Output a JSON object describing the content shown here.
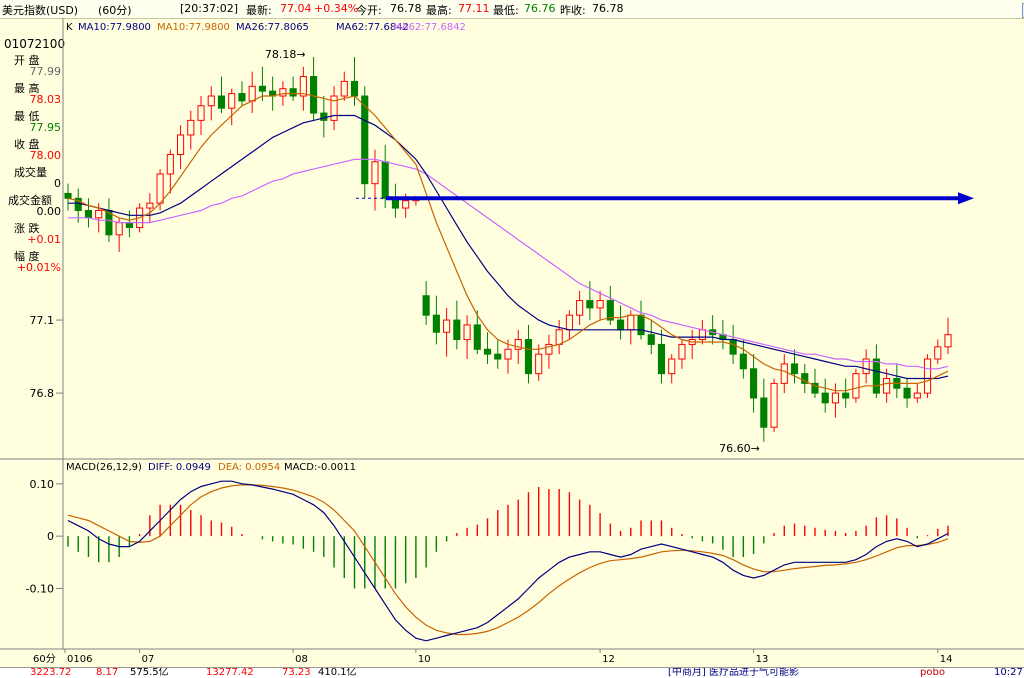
{
  "header": {
    "instrument": "美元指数(USD)",
    "period": "(60分)",
    "time": "[20:37:02]",
    "latest_label": "最新:",
    "latest": "77.04",
    "change_pct": "+0.34%",
    "open_label": "今开:",
    "open": "76.78",
    "high_label": "最高:",
    "high": "77.11",
    "low_label": "最低:",
    "low": "76.76",
    "prevclose_label": "昨收:",
    "prevclose": "76.78"
  },
  "legend": {
    "k": "K",
    "ma10a": "MA10:77.9800",
    "ma10b": "MA10:77.9800",
    "ma26": "MA26:77.8065",
    "ma62a": "MA62:77.6842",
    "ma62b": "MA62:77.6842"
  },
  "colors": {
    "bg": "#ffffe0",
    "up": "#ff0000",
    "down": "#008000",
    "ma10": "#c86400",
    "ma26": "#000080",
    "ma62": "#cc66ff",
    "arrow": "#0000cc",
    "axis": "#808080"
  },
  "info_panel": {
    "date": "01072100",
    "open_label": "开 盘",
    "open": "77.99",
    "high_label": "最 高",
    "high": "78.03",
    "low_label": "最 低",
    "low": "77.95",
    "close_label": "收 盘",
    "close": "78.00",
    "vol_label": "成交量",
    "vol": "0",
    "amount_label": "成交金额",
    "amount": "0.00",
    "chg_label": "涨 跌",
    "chg": "+0.01",
    "range_label": "幅 度",
    "range": "+0.01%"
  },
  "price_axis": {
    "ticks": [
      "77.1",
      "76.8"
    ]
  },
  "annotations": {
    "high_mark": "78.18",
    "low_mark": "76.60"
  },
  "macd_legend": {
    "name": "MACD(26,12,9)",
    "diff": "DIFF: 0.0949",
    "dea": "DEA: 0.0954",
    "macd": "MACD:-0.0011"
  },
  "macd_axis": {
    "ticks": [
      "0.10",
      "0",
      "-0.10"
    ]
  },
  "x_axis": {
    "period_label": "60分",
    "labels": [
      "0106",
      "07",
      "08",
      "10",
      "12",
      "13",
      "14"
    ]
  },
  "bottom_bar": {
    "a": "3223.72",
    "b": "8.17",
    "c": "575.5亿",
    "d": "13277.42",
    "e": "73.23",
    "f": "410.1亿",
    "news": "[中商月]  医疗品进于气可能影",
    "brand": "pobo",
    "clock": "10:27"
  },
  "chart_data": {
    "type": "candlestick",
    "price_range": [
      76.55,
      78.25
    ],
    "candles": [
      [
        77.62,
        77.66,
        77.55,
        77.6
      ],
      [
        77.6,
        77.64,
        77.5,
        77.55
      ],
      [
        77.55,
        77.6,
        77.48,
        77.52
      ],
      [
        77.52,
        77.58,
        77.46,
        77.55
      ],
      [
        77.55,
        77.6,
        77.42,
        77.45
      ],
      [
        77.45,
        77.52,
        77.38,
        77.5
      ],
      [
        77.5,
        77.55,
        77.44,
        77.48
      ],
      [
        77.48,
        77.58,
        77.46,
        77.56
      ],
      [
        77.56,
        77.62,
        77.5,
        77.58
      ],
      [
        77.58,
        77.72,
        77.55,
        77.7
      ],
      [
        77.7,
        77.8,
        77.62,
        77.78
      ],
      [
        77.78,
        77.9,
        77.72,
        77.86
      ],
      [
        77.86,
        77.96,
        77.8,
        77.92
      ],
      [
        77.92,
        78.02,
        77.86,
        77.98
      ],
      [
        77.98,
        78.06,
        77.92,
        78.02
      ],
      [
        78.02,
        78.1,
        77.95,
        77.97
      ],
      [
        77.97,
        78.05,
        77.9,
        78.03
      ],
      [
        78.03,
        78.08,
        77.98,
        78.0
      ],
      [
        78.0,
        78.12,
        77.95,
        78.06
      ],
      [
        78.06,
        78.14,
        78.0,
        78.04
      ],
      [
        78.04,
        78.1,
        77.96,
        78.02
      ],
      [
        78.02,
        78.08,
        77.98,
        78.05
      ],
      [
        78.05,
        78.1,
        78.0,
        78.02
      ],
      [
        78.02,
        78.14,
        77.96,
        78.1
      ],
      [
        78.1,
        78.18,
        77.92,
        77.95
      ],
      [
        77.95,
        78.02,
        77.85,
        77.92
      ],
      [
        77.92,
        78.06,
        77.88,
        78.02
      ],
      [
        78.02,
        78.12,
        78.0,
        78.08
      ],
      [
        78.08,
        78.18,
        77.98,
        78.02
      ],
      [
        78.02,
        78.06,
        77.6,
        77.66
      ],
      [
        77.66,
        77.8,
        77.55,
        77.75
      ],
      [
        77.75,
        77.82,
        77.56,
        77.6
      ],
      [
        77.6,
        77.66,
        77.52,
        77.56
      ],
      [
        77.56,
        77.62,
        77.52,
        77.59
      ],
      [
        77.59,
        77.61,
        77.57,
        77.6
      ],
      [
        77.2,
        77.26,
        77.08,
        77.12
      ],
      [
        77.12,
        77.2,
        77.0,
        77.05
      ],
      [
        77.05,
        77.15,
        76.95,
        77.1
      ],
      [
        77.1,
        77.18,
        76.98,
        77.02
      ],
      [
        77.02,
        77.12,
        76.94,
        77.08
      ],
      [
        77.08,
        77.14,
        76.96,
        76.98
      ],
      [
        76.98,
        77.05,
        76.92,
        76.96
      ],
      [
        76.96,
        77.02,
        76.9,
        76.94
      ],
      [
        76.94,
        77.02,
        76.88,
        76.98
      ],
      [
        76.98,
        77.06,
        76.92,
        77.02
      ],
      [
        77.02,
        77.08,
        76.84,
        76.88
      ],
      [
        76.88,
        77.0,
        76.85,
        76.96
      ],
      [
        76.96,
        77.04,
        76.9,
        77.0
      ],
      [
        77.0,
        77.1,
        76.96,
        77.06
      ],
      [
        77.06,
        77.14,
        77.02,
        77.12
      ],
      [
        77.12,
        77.22,
        77.08,
        77.18
      ],
      [
        77.18,
        77.26,
        77.1,
        77.15
      ],
      [
        77.15,
        77.22,
        77.1,
        77.18
      ],
      [
        77.18,
        77.24,
        77.08,
        77.1
      ],
      [
        77.1,
        77.16,
        77.02,
        77.06
      ],
      [
        77.06,
        77.14,
        77.0,
        77.12
      ],
      [
        77.12,
        77.18,
        77.02,
        77.04
      ],
      [
        77.04,
        77.1,
        76.96,
        77.0
      ],
      [
        77.0,
        77.06,
        76.84,
        76.88
      ],
      [
        76.88,
        76.96,
        76.84,
        76.94
      ],
      [
        76.94,
        77.02,
        76.9,
        77.0
      ],
      [
        77.0,
        77.06,
        76.94,
        77.02
      ],
      [
        77.02,
        77.1,
        77.0,
        77.06
      ],
      [
        77.06,
        77.12,
        77.0,
        77.04
      ],
      [
        77.04,
        77.1,
        76.98,
        77.02
      ],
      [
        77.02,
        77.08,
        76.92,
        76.96
      ],
      [
        76.96,
        77.02,
        76.86,
        76.9
      ],
      [
        76.9,
        76.96,
        76.72,
        76.78
      ],
      [
        76.78,
        76.86,
        76.6,
        76.66
      ],
      [
        76.66,
        76.86,
        76.64,
        76.84
      ],
      [
        76.84,
        76.96,
        76.8,
        76.92
      ],
      [
        76.92,
        76.98,
        76.84,
        76.88
      ],
      [
        76.88,
        76.92,
        76.8,
        76.84
      ],
      [
        76.84,
        76.9,
        76.78,
        76.8
      ],
      [
        76.8,
        76.86,
        76.72,
        76.76
      ],
      [
        76.76,
        76.84,
        76.7,
        76.8
      ],
      [
        76.8,
        76.86,
        76.74,
        76.78
      ],
      [
        76.78,
        76.9,
        76.76,
        76.88
      ],
      [
        76.88,
        76.98,
        76.84,
        76.94
      ],
      [
        76.94,
        77.0,
        76.78,
        76.8
      ],
      [
        76.8,
        76.9,
        76.76,
        76.86
      ],
      [
        76.86,
        76.92,
        76.78,
        76.82
      ],
      [
        76.82,
        76.86,
        76.74,
        76.78
      ],
      [
        76.78,
        76.84,
        76.76,
        76.8
      ],
      [
        76.8,
        76.96,
        76.78,
        76.94
      ],
      [
        76.94,
        77.02,
        76.92,
        76.99
      ],
      [
        76.99,
        77.11,
        76.96,
        77.04
      ]
    ],
    "ma10": [
      77.6,
      77.59,
      77.57,
      77.56,
      77.54,
      77.52,
      77.51,
      77.52,
      77.54,
      77.58,
      77.63,
      77.69,
      77.75,
      77.81,
      77.86,
      77.9,
      77.94,
      77.98,
      78.0,
      78.02,
      78.02,
      78.03,
      78.03,
      78.03,
      78.02,
      78.01,
      78.0,
      78.01,
      78.02,
      77.98,
      77.94,
      77.89,
      77.84,
      77.79,
      77.74,
      77.62,
      77.5,
      77.4,
      77.3,
      77.2,
      77.12,
      77.06,
      77.02,
      77.0,
      76.99,
      76.98,
      76.98,
      76.99,
      77.0,
      77.02,
      77.05,
      77.08,
      77.1,
      77.11,
      77.11,
      77.12,
      77.12,
      77.1,
      77.07,
      77.04,
      77.02,
      77.01,
      77.01,
      77.01,
      77.01,
      77.0,
      76.98,
      76.95,
      76.92,
      76.9,
      76.89,
      76.87,
      76.85,
      76.83,
      76.82,
      76.81,
      76.81,
      76.82,
      76.83,
      76.83,
      76.84,
      76.84,
      76.84,
      76.84,
      76.85,
      76.87,
      76.89
    ],
    "ma26": [
      77.58,
      77.58,
      77.57,
      77.56,
      77.55,
      77.54,
      77.53,
      77.53,
      77.53,
      77.54,
      77.56,
      77.58,
      77.61,
      77.64,
      77.67,
      77.7,
      77.73,
      77.76,
      77.79,
      77.82,
      77.85,
      77.87,
      77.89,
      77.91,
      77.92,
      77.93,
      77.94,
      77.94,
      77.94,
      77.92,
      77.9,
      77.87,
      77.84,
      77.8,
      77.76,
      77.7,
      77.63,
      77.56,
      77.49,
      77.42,
      77.36,
      77.3,
      77.25,
      77.2,
      77.16,
      77.13,
      77.1,
      77.08,
      77.07,
      77.06,
      77.06,
      77.06,
      77.06,
      77.06,
      77.06,
      77.06,
      77.06,
      77.05,
      77.04,
      77.03,
      77.03,
      77.03,
      77.03,
      77.03,
      77.02,
      77.02,
      77.01,
      77.0,
      76.99,
      76.98,
      76.97,
      76.96,
      76.95,
      76.94,
      76.93,
      76.92,
      76.91,
      76.91,
      76.9,
      76.89,
      76.88,
      76.87,
      76.86,
      76.86,
      76.86,
      76.86,
      76.87
    ],
    "ma62": [
      77.52,
      77.52,
      77.52,
      77.51,
      77.51,
      77.5,
      77.5,
      77.5,
      77.5,
      77.51,
      77.52,
      77.53,
      77.54,
      77.55,
      77.57,
      77.58,
      77.6,
      77.61,
      77.63,
      77.65,
      77.67,
      77.68,
      77.7,
      77.71,
      77.72,
      77.73,
      77.74,
      77.75,
      77.76,
      77.76,
      77.76,
      77.75,
      77.74,
      77.73,
      77.72,
      77.7,
      77.67,
      77.64,
      77.61,
      77.58,
      77.55,
      77.52,
      77.49,
      77.46,
      77.43,
      77.4,
      77.37,
      77.34,
      77.31,
      77.28,
      77.25,
      77.23,
      77.21,
      77.19,
      77.17,
      77.15,
      77.13,
      77.12,
      77.1,
      77.09,
      77.08,
      77.07,
      77.06,
      77.05,
      77.04,
      77.03,
      77.02,
      77.01,
      77.0,
      76.99,
      76.98,
      76.97,
      76.96,
      76.96,
      76.95,
      76.94,
      76.94,
      76.93,
      76.93,
      76.93,
      76.92,
      76.92,
      76.91,
      76.91,
      76.9,
      76.9,
      76.91
    ],
    "macd_range": [
      -0.21,
      0.115
    ],
    "diff": [
      0.03,
      0.02,
      0.01,
      -0.005,
      -0.015,
      -0.02,
      -0.02,
      -0.01,
      0.01,
      0.03,
      0.05,
      0.07,
      0.085,
      0.095,
      0.1,
      0.105,
      0.105,
      0.1,
      0.098,
      0.094,
      0.09,
      0.085,
      0.08,
      0.07,
      0.06,
      0.045,
      0.02,
      -0.01,
      -0.04,
      -0.07,
      -0.1,
      -0.13,
      -0.16,
      -0.18,
      -0.195,
      -0.2,
      -0.195,
      -0.19,
      -0.185,
      -0.18,
      -0.175,
      -0.165,
      -0.15,
      -0.135,
      -0.12,
      -0.1,
      -0.08,
      -0.065,
      -0.05,
      -0.04,
      -0.035,
      -0.03,
      -0.03,
      -0.035,
      -0.04,
      -0.035,
      -0.025,
      -0.02,
      -0.015,
      -0.02,
      -0.025,
      -0.03,
      -0.035,
      -0.04,
      -0.05,
      -0.065,
      -0.075,
      -0.08,
      -0.075,
      -0.065,
      -0.055,
      -0.05,
      -0.05,
      -0.05,
      -0.05,
      -0.05,
      -0.05,
      -0.045,
      -0.035,
      -0.02,
      -0.01,
      -0.005,
      -0.01,
      -0.02,
      -0.015,
      -0.005,
      0.005
    ],
    "dea": [
      0.04,
      0.035,
      0.03,
      0.02,
      0.01,
      0.0,
      -0.01,
      -0.012,
      -0.01,
      0.0,
      0.02,
      0.04,
      0.06,
      0.075,
      0.085,
      0.092,
      0.096,
      0.098,
      0.098,
      0.097,
      0.095,
      0.092,
      0.088,
      0.082,
      0.075,
      0.065,
      0.05,
      0.03,
      0.01,
      -0.02,
      -0.05,
      -0.08,
      -0.11,
      -0.135,
      -0.155,
      -0.17,
      -0.18,
      -0.185,
      -0.188,
      -0.188,
      -0.186,
      -0.182,
      -0.175,
      -0.165,
      -0.155,
      -0.142,
      -0.127,
      -0.11,
      -0.095,
      -0.082,
      -0.07,
      -0.06,
      -0.052,
      -0.047,
      -0.045,
      -0.043,
      -0.04,
      -0.035,
      -0.03,
      -0.028,
      -0.027,
      -0.028,
      -0.03,
      -0.033,
      -0.037,
      -0.045,
      -0.055,
      -0.063,
      -0.068,
      -0.068,
      -0.065,
      -0.062,
      -0.06,
      -0.058,
      -0.056,
      -0.055,
      -0.053,
      -0.05,
      -0.045,
      -0.038,
      -0.03,
      -0.022,
      -0.018,
      -0.018,
      -0.016,
      -0.012,
      -0.005
    ]
  }
}
